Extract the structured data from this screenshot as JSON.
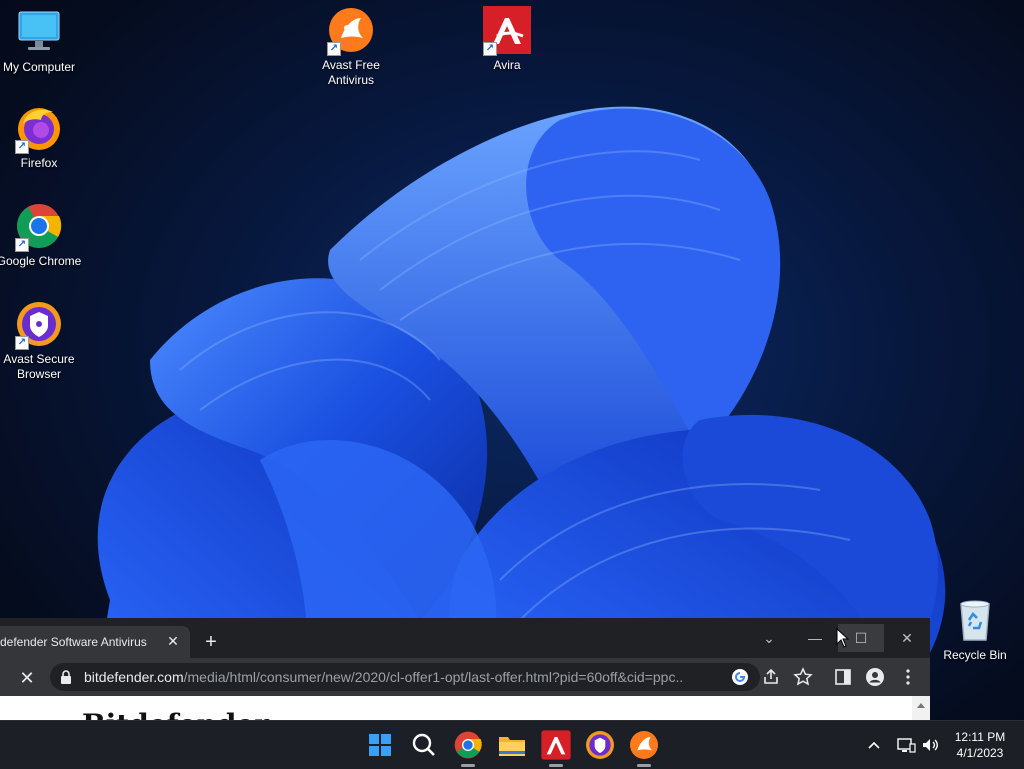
{
  "desktop": {
    "icons": [
      {
        "id": "my-computer",
        "label": "My Computer",
        "icon": "monitor-icon"
      },
      {
        "id": "avast-free-antivirus",
        "label": "Avast Free Antivirus",
        "icon": "avast-icon"
      },
      {
        "id": "avira",
        "label": "Avira",
        "icon": "avira-icon"
      },
      {
        "id": "firefox",
        "label": "Firefox",
        "icon": "firefox-icon"
      },
      {
        "id": "google-chrome",
        "label": "Google Chrome",
        "icon": "chrome-icon"
      },
      {
        "id": "avast-secure-browser",
        "label": "Avast Secure Browser",
        "icon": "avast-secure-browser-icon"
      },
      {
        "id": "recycle-bin",
        "label": "Recycle Bin",
        "icon": "recycle-bin-icon"
      }
    ]
  },
  "browser": {
    "tab_title": "defender Software Antivirus - ",
    "tab_close": "✕",
    "new_tab": "+",
    "url_host": "bitdefender.com",
    "url_path": "/media/html/consumer/new/2020/cl-offer1-opt/last-offer.html?pid=60off&cid=ppc...",
    "page_logo": "Bitdefender",
    "controls": {
      "chevron": "⌄",
      "minimize": "—",
      "maximize": "☐",
      "close": "✕"
    }
  },
  "taskbar": {
    "apps": [
      "start-icon",
      "search-icon",
      "chrome-icon",
      "file-explorer-icon",
      "avira-icon",
      "avast-secure-browser-icon",
      "avast-icon"
    ],
    "clock_time": "12:11 PM",
    "clock_date": "4/1/2023"
  },
  "colors": {
    "accent": "#1a73e8",
    "taskbar_bg": "#1c1f26",
    "browser_bg": "#202124"
  }
}
